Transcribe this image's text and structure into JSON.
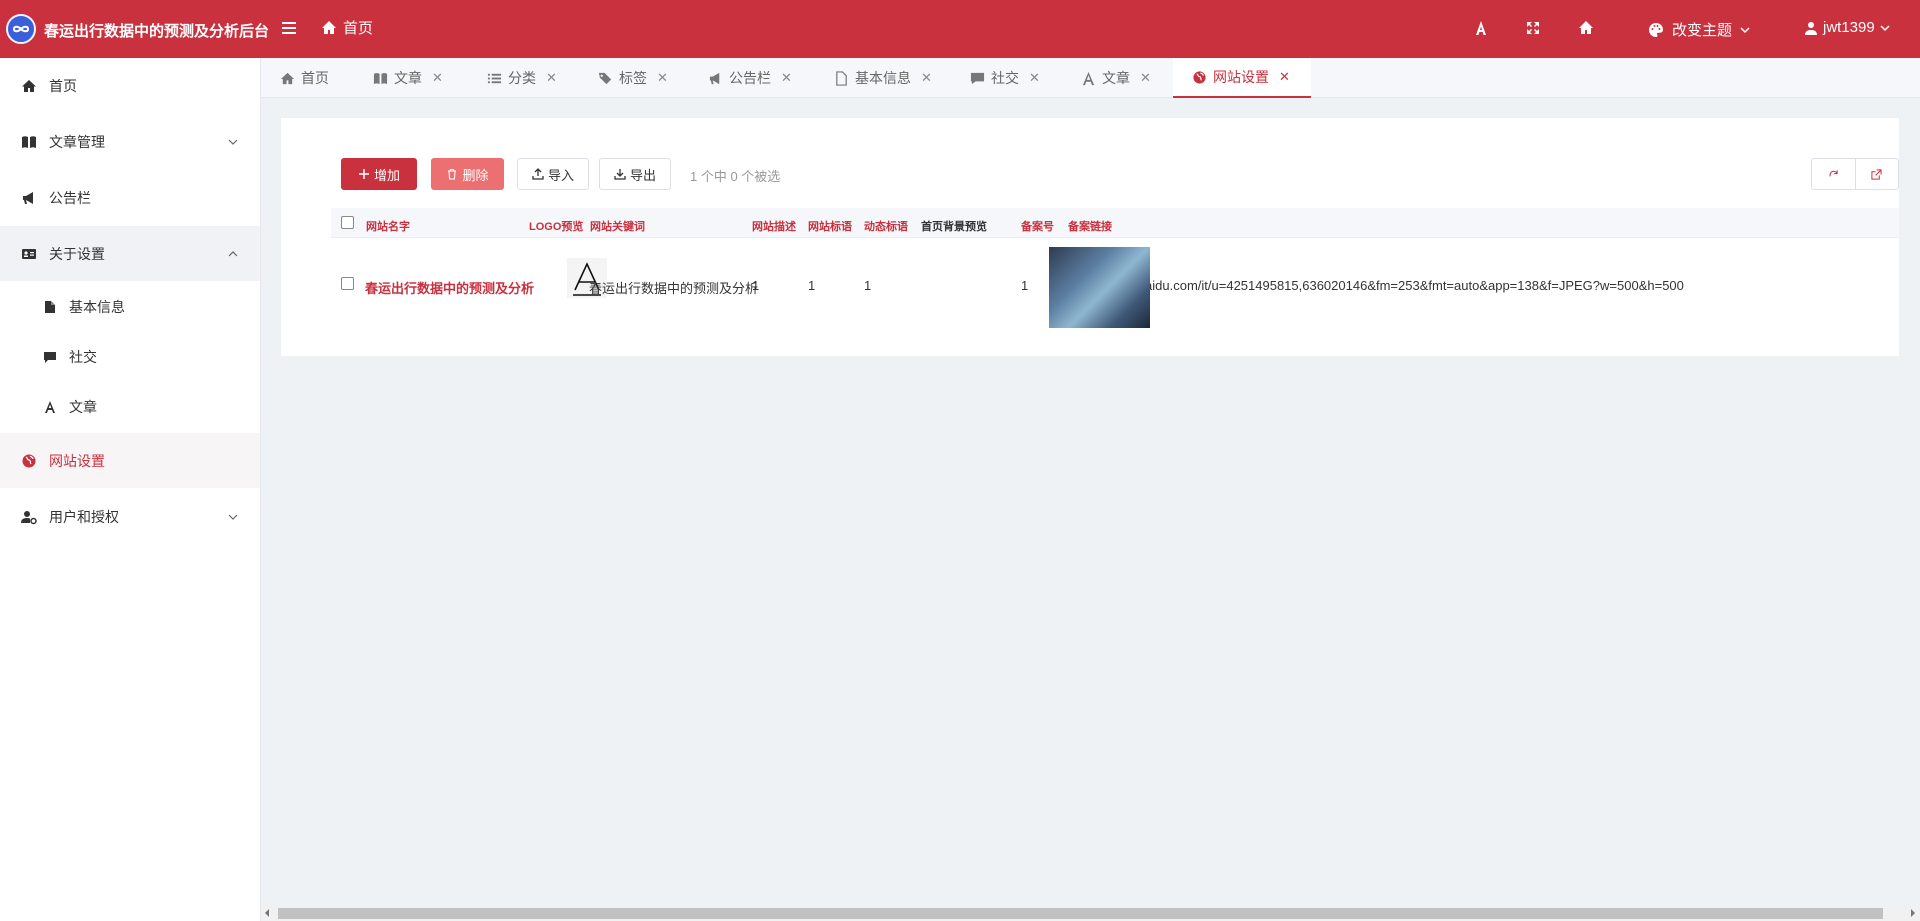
{
  "header": {
    "app_title": "春运出行数据中的预测及分析后台",
    "home_label": "首页",
    "theme_label": "改变主题",
    "username": "jwt1399"
  },
  "sidebar": {
    "items": [
      {
        "label": "首页",
        "icon": "home-icon"
      },
      {
        "label": "文章管理",
        "icon": "book-icon"
      },
      {
        "label": "公告栏",
        "icon": "bullhorn-icon"
      },
      {
        "label": "关于设置",
        "icon": "id-card-icon"
      },
      {
        "label": "网站设置",
        "icon": "globe-icon"
      },
      {
        "label": "用户和授权",
        "icon": "user-cog-icon"
      }
    ],
    "sub_items": [
      {
        "label": "基本信息",
        "icon": "file-icon"
      },
      {
        "label": "社交",
        "icon": "comment-icon"
      },
      {
        "label": "文章",
        "icon": "font-icon"
      }
    ]
  },
  "tabs": [
    {
      "label": "首页",
      "icon": "home-icon"
    },
    {
      "label": "文章",
      "icon": "book-icon"
    },
    {
      "label": "分类",
      "icon": "list-icon"
    },
    {
      "label": "标签",
      "icon": "tags-icon"
    },
    {
      "label": "公告栏",
      "icon": "bullhorn-icon"
    },
    {
      "label": "基本信息",
      "icon": "file-icon"
    },
    {
      "label": "社交",
      "icon": "comment-icon"
    },
    {
      "label": "文章",
      "icon": "font-icon"
    },
    {
      "label": "网站设置",
      "icon": "globe-icon"
    }
  ],
  "toolbar": {
    "add": "增加",
    "delete": "删除",
    "import": "导入",
    "export": "导出",
    "selection": "1 个中 0 个被选"
  },
  "table": {
    "columns": [
      "网站名字",
      "LOGO预览",
      "网站关键词",
      "网站描述",
      "网站标语",
      "动态标语",
      "首页背景预览",
      "备案号",
      "备案链接"
    ],
    "rows": [
      {
        "name": "春运出行数据中的预测及分析",
        "logo_letter": "A",
        "keywords": "春运出行数据中的预测及分析",
        "description": "1",
        "slogan": "1",
        "dynamic_slogan": "1",
        "record_no": "1",
        "record_link": "https://img2.baidu.com/it/u=4251495815,636020146&fm=253&fmt=auto&app=138&f=JPEG?w=500&h=500"
      }
    ]
  },
  "colors": {
    "primary": "#c9313f",
    "danger_light": "#ec7072",
    "background": "#eff2f5"
  }
}
